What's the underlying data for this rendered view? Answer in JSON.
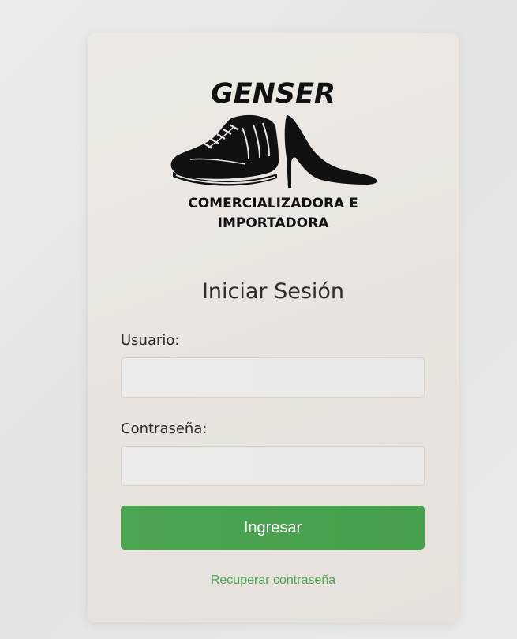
{
  "logo": {
    "brand": "GENSER",
    "subtitle_line1": "COMERCIALIZADORA E",
    "subtitle_line2": "IMPORTADORA",
    "icons": [
      "sneaker-icon",
      "high-heel-icon"
    ]
  },
  "form": {
    "title": "Iniciar Sesión",
    "username_label": "Usuario:",
    "username_value": "",
    "password_label": "Contraseña:",
    "password_value": "",
    "submit_label": "Ingresar",
    "recover_link": "Recuperar contraseña"
  },
  "colors": {
    "accent": "#4ca552",
    "card_background": "#ebe6e1",
    "page_background": "#e8e8e8"
  }
}
